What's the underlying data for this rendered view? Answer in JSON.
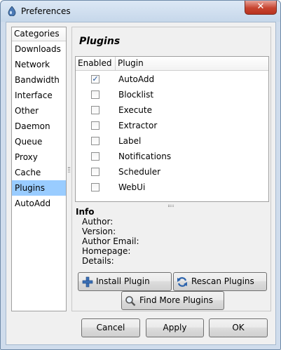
{
  "window": {
    "title": "Preferences",
    "close_glyph": "✕"
  },
  "categories": {
    "header": "Categories",
    "items": [
      "Downloads",
      "Network",
      "Bandwidth",
      "Interface",
      "Other",
      "Daemon",
      "Queue",
      "Proxy",
      "Cache",
      "Plugins",
      "AutoAdd"
    ],
    "selected": "Plugins"
  },
  "plugins_page": {
    "title": "Plugins",
    "columns": {
      "enabled": "Enabled",
      "plugin": "Plugin"
    },
    "rows": [
      {
        "name": "AutoAdd",
        "enabled": true
      },
      {
        "name": "Blocklist",
        "enabled": false
      },
      {
        "name": "Execute",
        "enabled": false
      },
      {
        "name": "Extractor",
        "enabled": false
      },
      {
        "name": "Label",
        "enabled": false
      },
      {
        "name": "Notifications",
        "enabled": false
      },
      {
        "name": "Scheduler",
        "enabled": false
      },
      {
        "name": "WebUi",
        "enabled": false
      }
    ],
    "info": {
      "title": "Info",
      "author": "Author:",
      "version": "Version:",
      "author_email": "Author Email:",
      "homepage": "Homepage:",
      "details": "Details:"
    },
    "install_button": "Install Plugin",
    "rescan_button": "Rescan Plugins",
    "find_button": "Find More Plugins"
  },
  "footer": {
    "cancel": "Cancel",
    "apply": "Apply",
    "ok": "OK"
  },
  "colors": {
    "selection": "#99ccff",
    "close": "#c7442f",
    "check": "#21569b"
  },
  "icons": {
    "app": "deluge-icon",
    "install": "plus-icon",
    "rescan": "refresh-icon",
    "find": "magnifier-icon"
  }
}
